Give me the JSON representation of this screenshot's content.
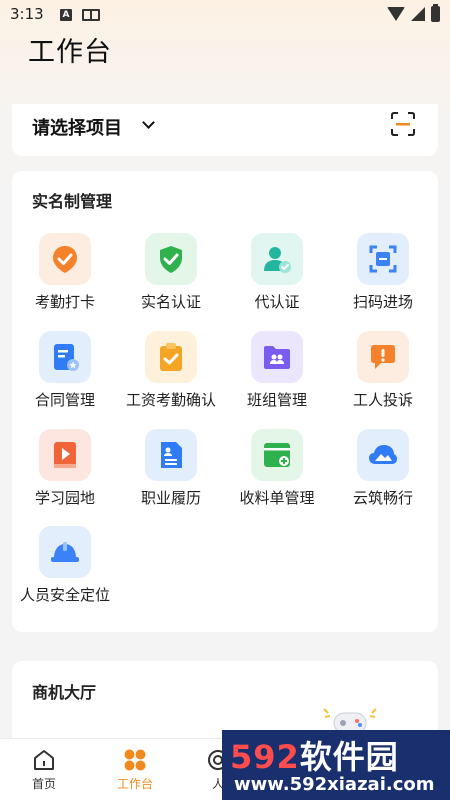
{
  "status_bar": {
    "time": "3:13",
    "a_badge": "A"
  },
  "header": {
    "title": "工作台"
  },
  "project_selector": {
    "label": "请选择项目"
  },
  "real_name_section": {
    "title": "实名制管理",
    "items": [
      {
        "label": "考勤打卡",
        "icon": "attendance-check-icon",
        "color": "#f5822a"
      },
      {
        "label": "实名认证",
        "icon": "shield-check-icon",
        "color": "#2fb14d"
      },
      {
        "label": "代认证",
        "icon": "user-verify-icon",
        "color": "#22b5a0"
      },
      {
        "label": "扫码进场",
        "icon": "scan-entry-icon",
        "color": "#3b82f6"
      },
      {
        "label": "合同管理",
        "icon": "contract-icon",
        "color": "#2f7cf6"
      },
      {
        "label": "工资考勤确认",
        "icon": "clipboard-check-icon",
        "color": "#f5a524"
      },
      {
        "label": "班组管理",
        "icon": "team-folder-icon",
        "color": "#7b5cf0"
      },
      {
        "label": "工人投诉",
        "icon": "complaint-icon",
        "color": "#f5822a"
      },
      {
        "label": "学习园地",
        "icon": "video-book-icon",
        "color": "#f0643a"
      },
      {
        "label": "职业履历",
        "icon": "resume-icon",
        "color": "#2f7cf6"
      },
      {
        "label": "收料单管理",
        "icon": "material-box-icon",
        "color": "#2fb14d"
      },
      {
        "label": "云筑畅行",
        "icon": "cloud-icon",
        "color": "#2f7cf6"
      },
      {
        "label": "人员安全定位",
        "icon": "helmet-icon",
        "color": "#3b82f6"
      }
    ]
  },
  "business_section": {
    "title": "商机大厅"
  },
  "bottom_nav": {
    "items": [
      {
        "label": "首页",
        "icon": "home-icon"
      },
      {
        "label": "工作台",
        "icon": "workbench-icon",
        "active": true
      },
      {
        "label": "人",
        "icon": "person-icon"
      }
    ]
  },
  "watermark": {
    "brand_num": "592",
    "brand_text": "软件园",
    "url": "www.592xiazai.com"
  }
}
